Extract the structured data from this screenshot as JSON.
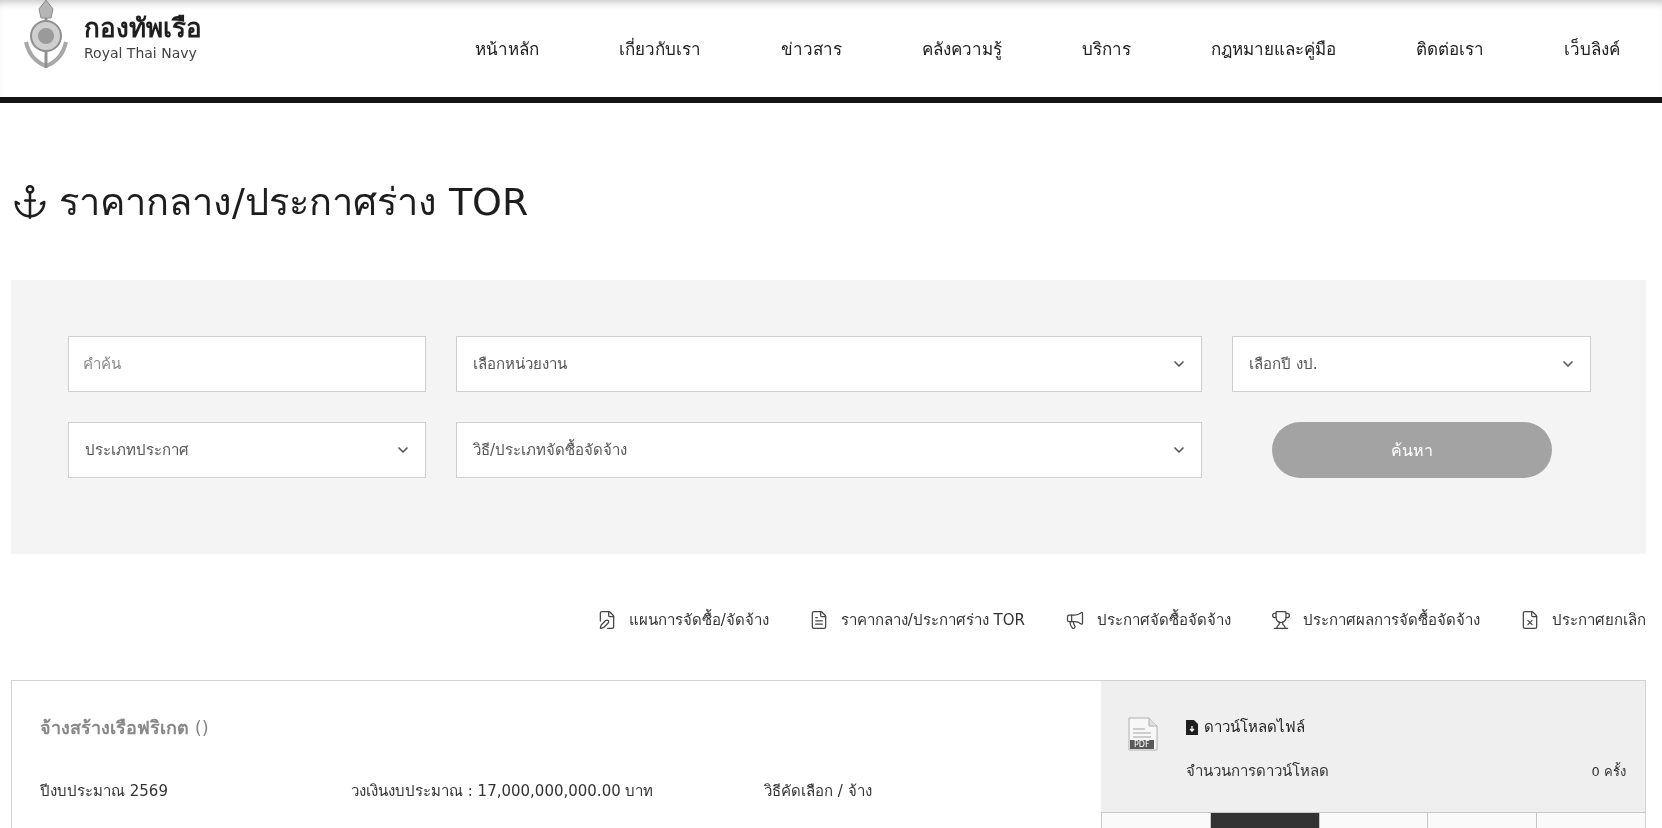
{
  "header": {
    "logo_title": "กองทัพเรือ",
    "logo_subtitle": "Royal Thai Navy",
    "nav": [
      "หน้าหลัก",
      "เกี่ยวกับเรา",
      "ข่าวสาร",
      "คลังความรู้",
      "บริการ",
      "กฎหมายและคู่มือ",
      "ติดต่อเรา",
      "เว็บลิงค์"
    ]
  },
  "page_title": "ราคากลาง/ประกาศร่าง TOR",
  "search": {
    "fields": [
      {
        "kind": "input",
        "placeholder": "คำค้น"
      },
      {
        "kind": "select",
        "value": "เลือกหน่วยงาน"
      },
      {
        "kind": "select",
        "value": "เลือกปี งป."
      },
      {
        "kind": "select",
        "value": "ประเภทประกาศ"
      },
      {
        "kind": "select",
        "value": "วิธี/ประเภทจัดซื้อจัดจ้าง"
      }
    ],
    "button": "ค้นหา"
  },
  "categories": [
    "แผนการจัดซื้อ/จัดจ้าง",
    "ราคากลาง/ประกาศร่าง TOR",
    "ประกาศจัดซื้อจัดจ้าง",
    "ประกาศผลการจัดซื้อจัดจ้าง",
    "ประกาศยกเลิก"
  ],
  "result": {
    "title": "**จ้างสร้างเรือฟริเกต** ()",
    "details": [
      "ปีงบประมาณ 2569",
      "วงเงินงบประมาณ : 17,000,000,000.00 บาท",
      "วิธีคัดเลือก / จ้าง"
    ],
    "download": {
      "file_type": "PDF",
      "link": "ดาวน์โหลดไฟล์",
      "count_label": "จำนวนการดาวน์โหลด",
      "count": "0 ครั้ง",
      "strip": [
        {
          "selected": false
        },
        {
          "selected": true
        },
        {
          "selected": false
        },
        {
          "selected": false
        },
        {
          "selected": false
        }
      ]
    }
  }
}
